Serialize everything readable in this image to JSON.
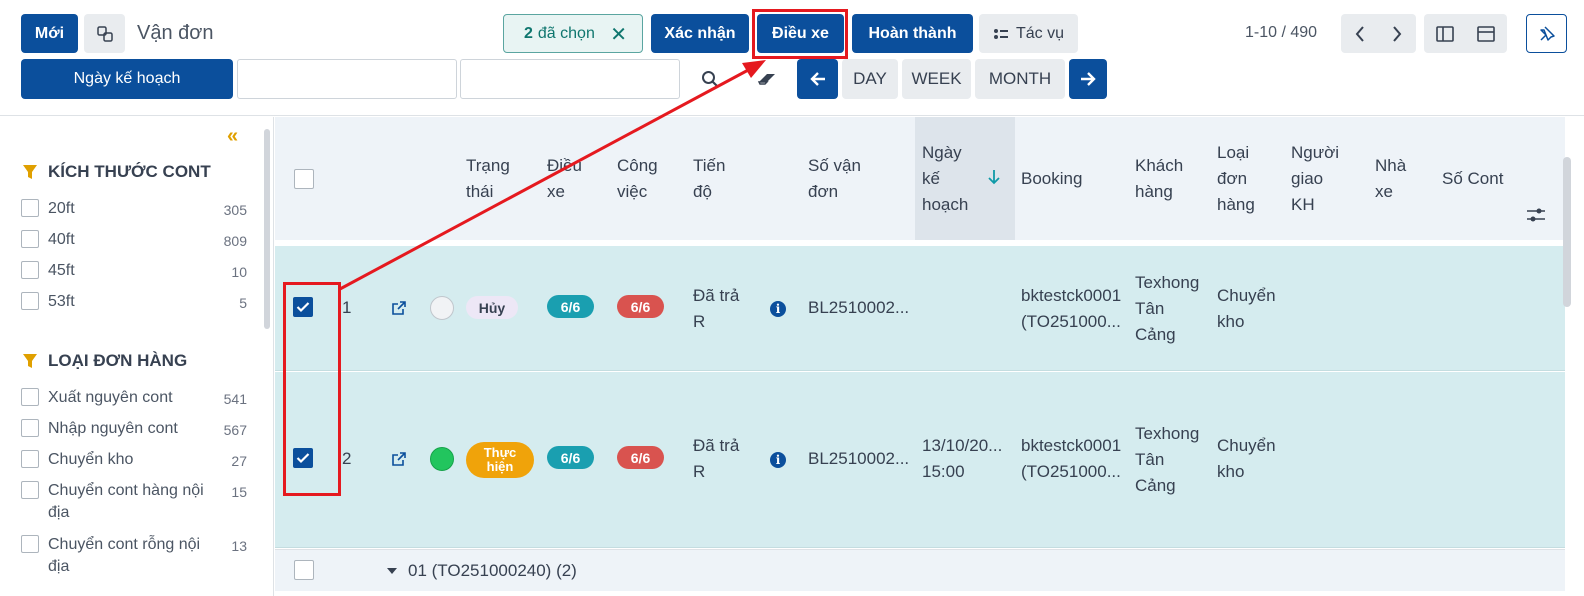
{
  "header": {
    "new_button": "Mới",
    "breadcrumb": "Vận đơn",
    "selection": {
      "count": "2",
      "label": "đã chọn"
    },
    "actions": [
      "Xác nhận",
      "Điều xe",
      "Hoàn thành"
    ],
    "more_actions": "Tác vụ",
    "pager": "1-10 / 490"
  },
  "date_bar": {
    "field_button": "Ngày kế hoạch",
    "periods": [
      "DAY",
      "WEEK",
      "MONTH"
    ]
  },
  "sidebar": {
    "groups": [
      {
        "title": "KÍCH THƯỚC CONT",
        "items": [
          {
            "label": "20ft",
            "count": "305"
          },
          {
            "label": "40ft",
            "count": "809"
          },
          {
            "label": "45ft",
            "count": "10"
          },
          {
            "label": "53ft",
            "count": "5"
          }
        ]
      },
      {
        "title": "LOẠI ĐƠN HÀNG",
        "items": [
          {
            "label": "Xuất nguyên cont",
            "count": "541"
          },
          {
            "label": "Nhập nguyên cont",
            "count": "567"
          },
          {
            "label": "Chuyển kho",
            "count": "27"
          },
          {
            "label": "Chuyển cont hàng nội địa",
            "count": "15"
          },
          {
            "label": "Chuyển cont rỗng nội địa",
            "count": "13"
          }
        ]
      }
    ]
  },
  "table": {
    "columns": {
      "status": "Trạng thái",
      "dispatch": "Điều xe",
      "work": "Công việc",
      "progress": "Tiến độ",
      "bl_number": "Số vận đơn",
      "plan_date": "Ngày kế hoạch",
      "booking": "Booking",
      "customer": "Khách hàng",
      "order_type": "Loại đơn hàng",
      "delivery_person": "Người giao KH",
      "carrier": "Nhà xe",
      "cont_number": "Số Cont"
    },
    "rows": [
      {
        "index": "1",
        "status": "Hủy",
        "dispatch": "6/6",
        "work": "6/6",
        "progress": "Đã trả R",
        "bl_number": "BL2510002...",
        "plan_date": "",
        "booking": "bktestck0001 (TO251000...",
        "customer": "Texhong Tân Cảng",
        "order_type": "Chuyển kho"
      },
      {
        "index": "2",
        "status": "Thực hiện",
        "dispatch": "6/6",
        "work": "6/6",
        "progress": "Đã trả R",
        "bl_number": "BL2510002...",
        "plan_date": "13/10/20... 15:00",
        "booking": "bktestck0001 (TO251000...",
        "customer": "Texhong Tân Cảng",
        "order_type": "Chuyển kho"
      }
    ],
    "group_row": "01 (TO251000240) (2)"
  },
  "colors": {
    "primary": "#0b4f9c",
    "selection": "#0f766e",
    "row_selected": "#d5ecef",
    "cancel_badge": "#ede7f6",
    "doing_badge": "#f0a30a",
    "dispatch_pill": "#1a9fb0",
    "work_pill": "#d9534f",
    "annotation": "#e5191f",
    "state_green": "#22c55e"
  },
  "icons": [
    "copy-icon",
    "close-icon",
    "dispatch-icon",
    "chevron-left-icon",
    "chevron-right-icon",
    "panel-icon",
    "layout-icon",
    "pin-icon",
    "search-icon",
    "eraser-icon",
    "arrow-left-icon",
    "arrow-right-icon",
    "filter-icon",
    "external-link-icon",
    "info-icon",
    "sort-down-icon",
    "settings-sliders-icon",
    "caret-down-icon",
    "collapse-icon"
  ]
}
